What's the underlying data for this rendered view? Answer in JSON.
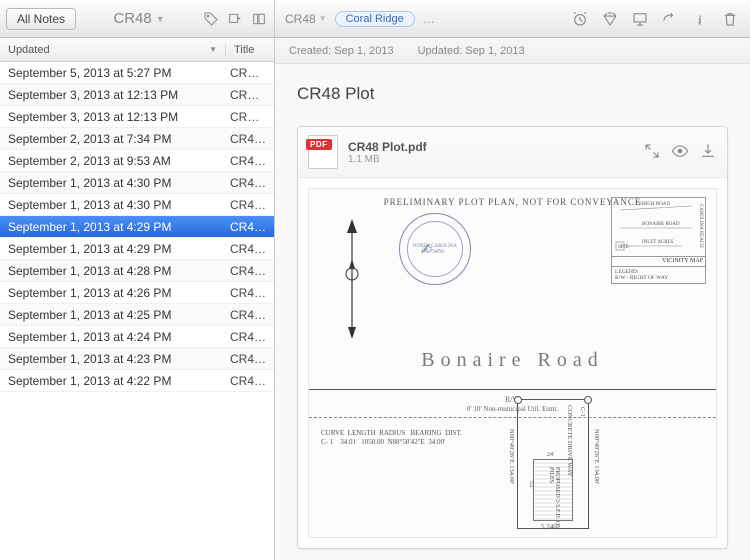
{
  "sidebar": {
    "all_notes_label": "All Notes",
    "notebook_name": "CR48",
    "columns": {
      "updated": "Updated",
      "title": "Title"
    },
    "notes": [
      {
        "date": "September 5, 2013 at 5:27 PM",
        "title": "CR…",
        "selected": false
      },
      {
        "date": "September 3, 2013 at 12:13 PM",
        "title": "CR…",
        "selected": false
      },
      {
        "date": "September 3, 2013 at 12:13 PM",
        "title": "CR…",
        "selected": false
      },
      {
        "date": "September 2, 2013 at 7:34 PM",
        "title": "CR4…",
        "selected": false
      },
      {
        "date": "September 2, 2013 at 9:53 AM",
        "title": "CR4…",
        "selected": false
      },
      {
        "date": "September 1, 2013 at 4:30 PM",
        "title": "CR4…",
        "selected": false
      },
      {
        "date": "September 1, 2013 at 4:30 PM",
        "title": "CR4…",
        "selected": false
      },
      {
        "date": "September 1, 2013 at 4:29 PM",
        "title": "CR4…",
        "selected": true
      },
      {
        "date": "September 1, 2013 at 4:29 PM",
        "title": "CR4…",
        "selected": false
      },
      {
        "date": "September 1, 2013 at 4:28 PM",
        "title": "CR4…",
        "selected": false
      },
      {
        "date": "September 1, 2013 at 4:26 PM",
        "title": "CR4…",
        "selected": false
      },
      {
        "date": "September 1, 2013 at 4:25 PM",
        "title": "CR4…",
        "selected": false
      },
      {
        "date": "September 1, 2013 at 4:24 PM",
        "title": "CR4…",
        "selected": false
      },
      {
        "date": "September 1, 2013 at 4:23 PM",
        "title": "CR4…",
        "selected": false
      },
      {
        "date": "September 1, 2013 at 4:22 PM",
        "title": "CR4…",
        "selected": false
      }
    ]
  },
  "main": {
    "breadcrumb_notebook": "CR48",
    "tag": "Coral Ridge",
    "tag_more": "…",
    "created_label": "Created:",
    "created_value": "Sep 1, 2013",
    "updated_label": "Updated:",
    "updated_value": "Sep 1, 2013",
    "note_title": "CR48 Plot"
  },
  "attachment": {
    "filename": "CR48 Plot.pdf",
    "filesize": "1.1 MB"
  },
  "plot": {
    "header": "PRELIMINARY PLOT PLAN, NOT FOR CONVEYANCE",
    "road_name": "Bonaire Road",
    "rw_label": "R/W",
    "easement": "0' 10' Non-municipal Util. Esmt.",
    "curve_header": "CURVE  LENGTH  RADIUS   BEARING  DIST.",
    "curve_row": "C- 1    34.01   1050.00  N88°58'42\"E  34.00'",
    "vicinity_title": "VICINITY MAP",
    "legend_title": "LEGEND:",
    "legend_row": "R/W - RIGHT OF WAY",
    "vic_labels": {
      "a": "LEHIGH ROAD",
      "b": "BONAIRE ROAD",
      "c": "INLET ACRES",
      "d": "CAROLINA BEACH"
    },
    "lot_left_bearing": "N00°49'26\"E  134.00'",
    "lot_right_bearing": "N00°49'26\"E  134.00'",
    "lot_drive": "CONCRETE DRIVE WAY",
    "lot_drive2": "C-1",
    "house_label": "PROPOSED 2-S.F.D. ON PILES",
    "house_w": "24'",
    "house_h": "52'",
    "lot_area": "5,246",
    "seal_text": "NORTH CAROLINA"
  }
}
